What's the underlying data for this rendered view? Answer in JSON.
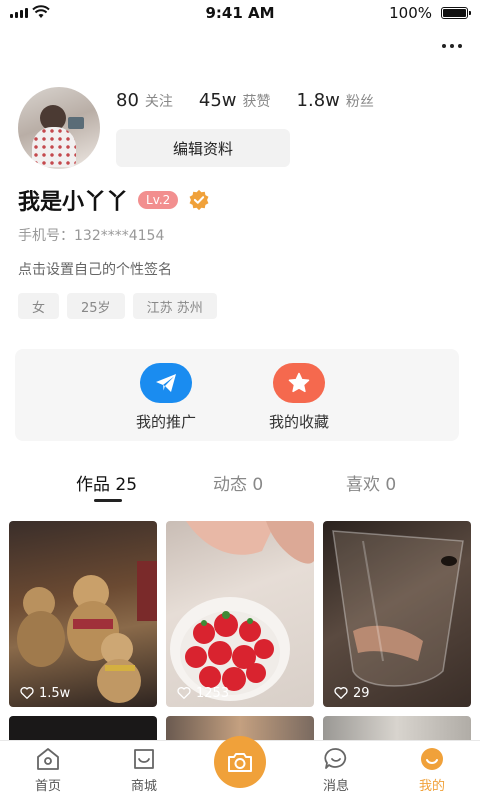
{
  "status_bar": {
    "time": "9:41 AM",
    "battery": "100%"
  },
  "profile": {
    "stats": [
      {
        "value": "80",
        "label": "关注"
      },
      {
        "value": "45w",
        "label": "获赞"
      },
      {
        "value": "1.8w",
        "label": "粉丝"
      }
    ],
    "edit_label": "编辑资料",
    "name": "我是小丫丫",
    "level": "Lv.2",
    "phone": "手机号：132****4154",
    "signature": "点击设置自己的个性签名",
    "tags": [
      "女",
      "25岁",
      "江苏 苏州"
    ]
  },
  "actions": [
    {
      "label": "我的推广",
      "icon": "paper-plane-icon",
      "color": "#1a8cf0"
    },
    {
      "label": "我的收藏",
      "icon": "star-icon",
      "color": "#f5694e"
    }
  ],
  "tabs": [
    {
      "label": "作品 25",
      "active": true
    },
    {
      "label": "动态 0",
      "active": false
    },
    {
      "label": "喜欢 0",
      "active": false
    }
  ],
  "posts": [
    {
      "likes": "1.5w"
    },
    {
      "likes": "1253"
    },
    {
      "likes": "29"
    }
  ],
  "nav": [
    {
      "label": "首页",
      "icon": "home-icon"
    },
    {
      "label": "商城",
      "icon": "shopping-bag-icon"
    },
    {
      "label": "",
      "icon": "camera-icon"
    },
    {
      "label": "消息",
      "icon": "message-icon"
    },
    {
      "label": "我的",
      "icon": "profile-face-icon",
      "active": true
    }
  ],
  "colors": {
    "accent": "#f0a13a",
    "level_badge": "#f28f8f",
    "promo": "#1a8cf0",
    "favorite": "#f5694e"
  }
}
